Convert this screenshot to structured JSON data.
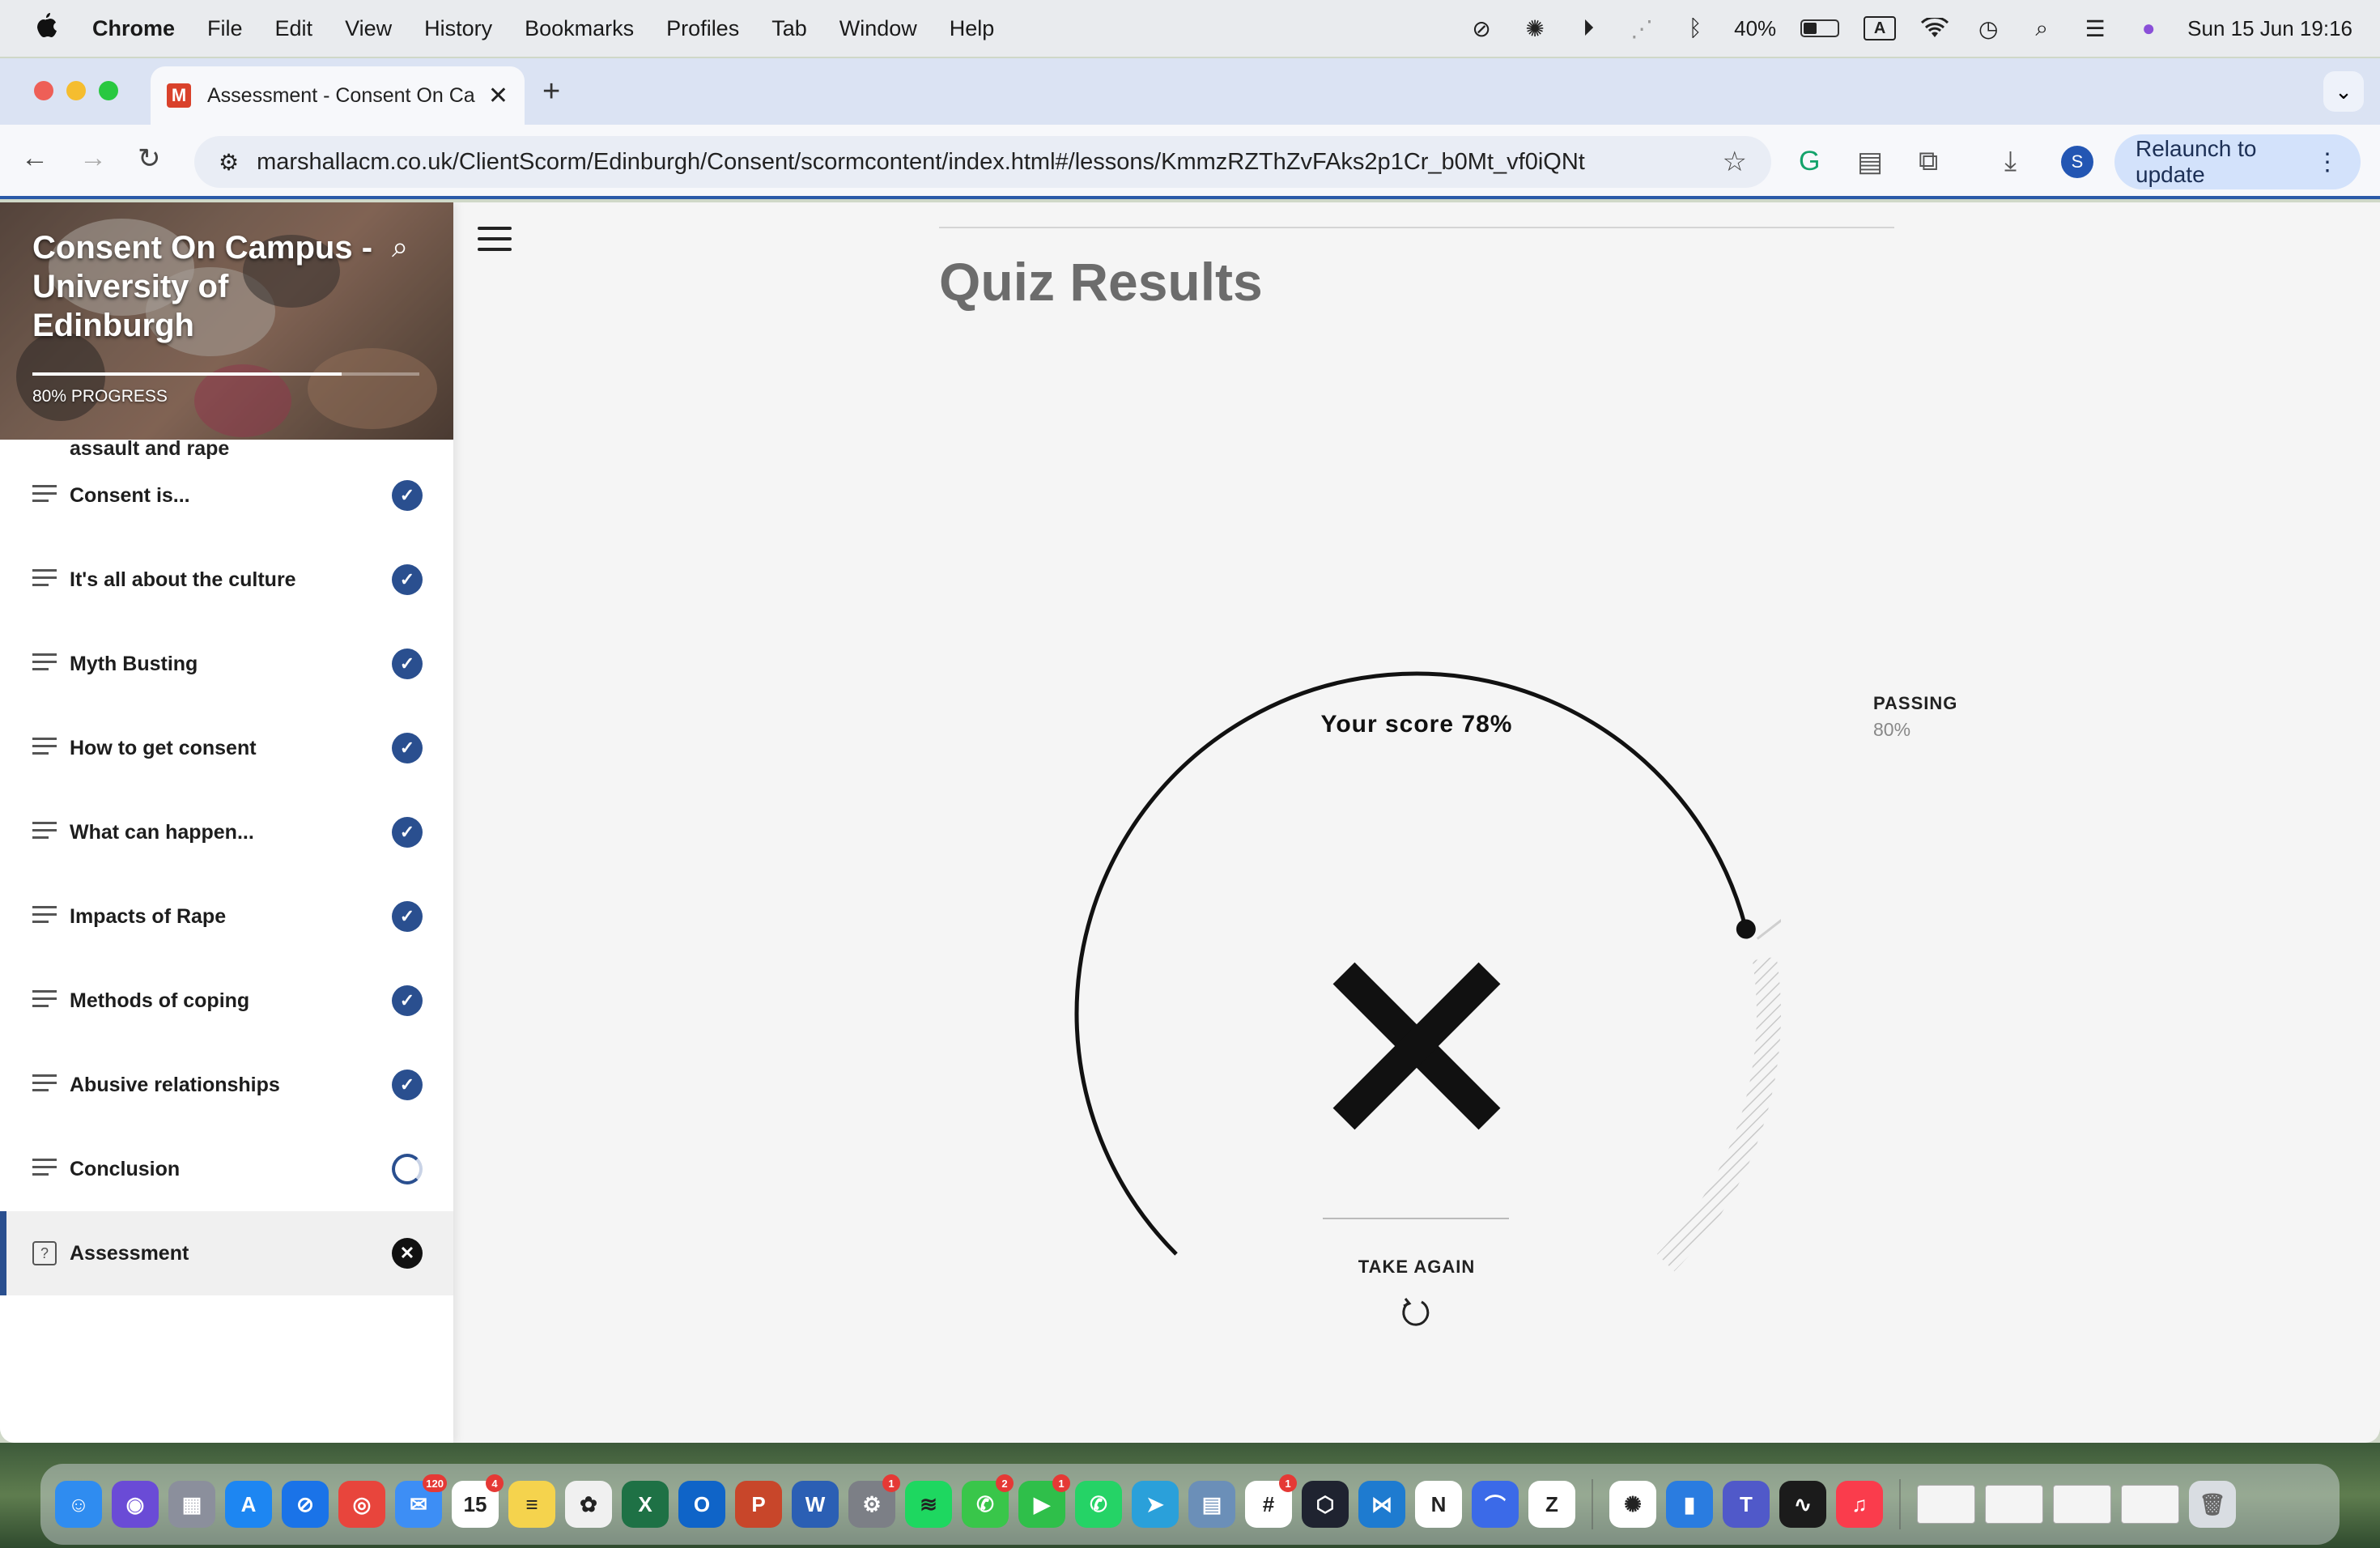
{
  "menubar": {
    "app_name": "Chrome",
    "menus": [
      "File",
      "Edit",
      "View",
      "History",
      "Bookmarks",
      "Profiles",
      "Tab",
      "Window",
      "Help"
    ],
    "battery_percent": "40%",
    "battery_level": 0.4,
    "input_source": "A",
    "datetime": "Sun 15 Jun  19:16"
  },
  "browser": {
    "tab_title": "Assessment - Consent On Ca",
    "tab_favicon_letter": "M",
    "url": "marshallacm.co.uk/ClientScorm/Edinburgh/Consent/scormcontent/index.html#/lessons/KmmzRZThZvFAks2p1Cr_b0Mt_vf0iQNt",
    "profile_initial": "S",
    "relaunch_label": "Relaunch to update"
  },
  "course": {
    "title": "Consent On Campus - University of Edinburgh",
    "progress_label": "80% PROGRESS",
    "progress_fraction": 0.8,
    "partial_item": "assault and rape",
    "lessons": [
      {
        "label": "Consent is...",
        "status": "complete"
      },
      {
        "label": "It's all about the culture",
        "status": "complete"
      },
      {
        "label": "Myth Busting",
        "status": "complete"
      },
      {
        "label": "How to get consent",
        "status": "complete"
      },
      {
        "label": "What can happen...",
        "status": "complete"
      },
      {
        "label": "Impacts of Rape",
        "status": "complete"
      },
      {
        "label": "Methods of coping",
        "status": "complete"
      },
      {
        "label": "Abusive relationships",
        "status": "complete"
      },
      {
        "label": "Conclusion",
        "status": "in-progress"
      },
      {
        "label": "Assessment",
        "status": "failed",
        "active": true
      }
    ]
  },
  "quiz": {
    "heading": "Quiz Results",
    "score_label": "Your score 78%",
    "score_fraction": 0.78,
    "passing_label": "PASSING",
    "passing_value": "80%",
    "passing_fraction": 0.8,
    "take_again_label": "TAKE AGAIN"
  },
  "dock": {
    "apps": [
      {
        "name": "finder",
        "color": "#2f8cf0",
        "glyph": "☺"
      },
      {
        "name": "siri",
        "color": "#6a4bd6",
        "glyph": "◉"
      },
      {
        "name": "launchpad",
        "color": "#8b8f9c",
        "glyph": "▦"
      },
      {
        "name": "app-store",
        "color": "#1d86f2",
        "glyph": "A"
      },
      {
        "name": "safari",
        "color": "#1a73e8",
        "glyph": "⊘"
      },
      {
        "name": "chrome",
        "color": "#e8453c",
        "glyph": "◎"
      },
      {
        "name": "mail",
        "color": "#3d8ef5",
        "glyph": "✉",
        "badge": "120"
      },
      {
        "name": "calendar",
        "color": "#ffffff",
        "glyph": "15",
        "badge": "4",
        "dark": true
      },
      {
        "name": "notes",
        "color": "#f5d34d",
        "glyph": "≡",
        "dark": true
      },
      {
        "name": "photos",
        "color": "#f0f0f0",
        "glyph": "✿",
        "dark": true
      },
      {
        "name": "excel",
        "color": "#1e7145",
        "glyph": "X"
      },
      {
        "name": "outlook",
        "color": "#0f64c8",
        "glyph": "O"
      },
      {
        "name": "powerpoint",
        "color": "#c8462a",
        "glyph": "P"
      },
      {
        "name": "word",
        "color": "#2b5fb4",
        "glyph": "W"
      },
      {
        "name": "system-settings",
        "color": "#7c7f86",
        "glyph": "⚙",
        "badge": "1"
      },
      {
        "name": "spotify",
        "color": "#1ed760",
        "glyph": "≋",
        "dark": true
      },
      {
        "name": "messages",
        "color": "#39c64a",
        "glyph": "✆",
        "badge": "2"
      },
      {
        "name": "facetime",
        "color": "#2fbf4a",
        "glyph": "▶",
        "badge": "1"
      },
      {
        "name": "whatsapp",
        "color": "#25d366",
        "glyph": "✆"
      },
      {
        "name": "telegram",
        "color": "#2aa0da",
        "glyph": "➤"
      },
      {
        "name": "preview",
        "color": "#6b8fb8",
        "glyph": "▤"
      },
      {
        "name": "slack",
        "color": "#ffffff",
        "glyph": "#",
        "badge": "1",
        "dark": true
      },
      {
        "name": "cursor",
        "color": "#1f2330",
        "glyph": "⬡"
      },
      {
        "name": "vscode",
        "color": "#1e7bd0",
        "glyph": "⋈"
      },
      {
        "name": "notion",
        "color": "#ffffff",
        "glyph": "N",
        "dark": true
      },
      {
        "name": "nordvpn",
        "color": "#3b6ae8",
        "glyph": "⌒"
      },
      {
        "name": "zotero",
        "color": "#ffffff",
        "glyph": "Z",
        "dark": true
      },
      {
        "name": "chatgpt",
        "color": "#ffffff",
        "glyph": "✺",
        "dark": true
      },
      {
        "name": "keynote",
        "color": "#2a7ce0",
        "glyph": "▮"
      },
      {
        "name": "teams",
        "color": "#5059c9",
        "glyph": "T"
      },
      {
        "name": "activity-monitor",
        "color": "#1b1b1b",
        "glyph": "∿"
      },
      {
        "name": "music",
        "color": "#fa3c4c",
        "glyph": "♫"
      }
    ]
  }
}
